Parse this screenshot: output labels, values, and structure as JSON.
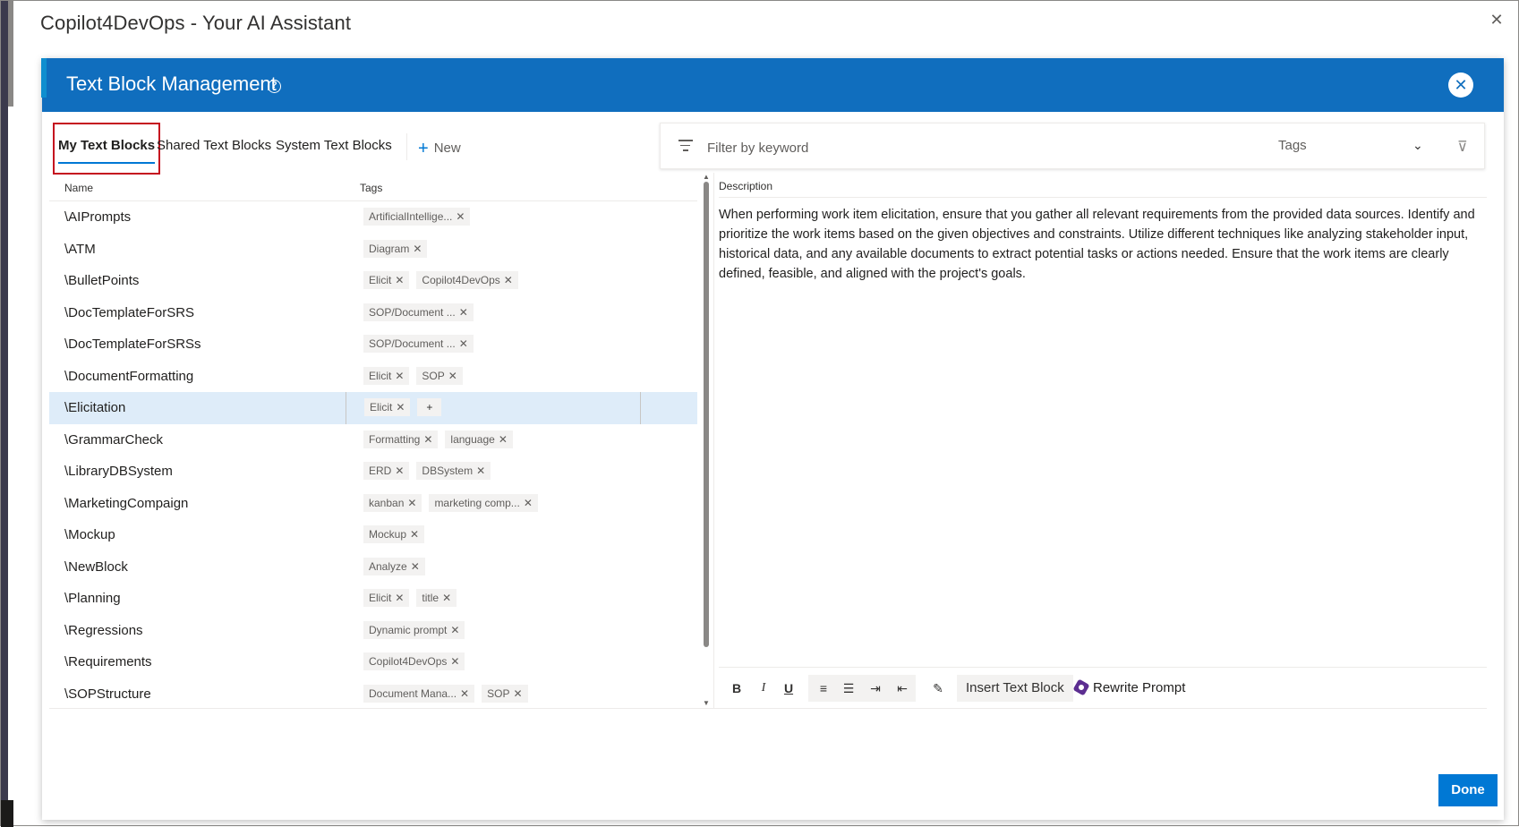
{
  "outer": {
    "title": "Copilot4DevOps - Your AI Assistant",
    "close_glyph": "✕"
  },
  "dialog": {
    "title": "Text Block Management",
    "help_glyph": "?",
    "close_glyph": "✕",
    "accent_color": "#106ebe"
  },
  "tabs": [
    {
      "label": "My Text Blocks",
      "active": true
    },
    {
      "label": "Shared Text Blocks",
      "active": false
    },
    {
      "label": "System Text Blocks",
      "active": false
    }
  ],
  "new_button": {
    "icon": "plus-icon",
    "glyph": "+",
    "label": "New"
  },
  "filter": {
    "placeholder": "Filter by keyword",
    "value": "",
    "tags_label": "Tags",
    "chevron_glyph": "⌄",
    "clear_glyph": "⊽"
  },
  "list": {
    "headers": {
      "name": "Name",
      "tags": "Tags"
    },
    "rows": [
      {
        "name": "\\AIPrompts",
        "tags": [
          "ArtificialIntellige..."
        ]
      },
      {
        "name": "\\ATM",
        "tags": [
          "Diagram"
        ]
      },
      {
        "name": "\\BulletPoints",
        "tags": [
          "Elicit",
          "Copilot4DevOps"
        ]
      },
      {
        "name": "\\DocTemplateForSRS",
        "tags": [
          "SOP/Document ..."
        ]
      },
      {
        "name": "\\DocTemplateForSRSs",
        "tags": [
          "SOP/Document ..."
        ]
      },
      {
        "name": "\\DocumentFormatting",
        "tags": [
          "Elicit",
          "SOP"
        ]
      },
      {
        "name": "\\Elicitation",
        "tags": [
          "Elicit"
        ],
        "selected": true,
        "add_tag": "+"
      },
      {
        "name": "\\GrammarCheck",
        "tags": [
          "Formatting",
          "language"
        ]
      },
      {
        "name": "\\LibraryDBSystem",
        "tags": [
          "ERD",
          "DBSystem"
        ]
      },
      {
        "name": "\\MarketingCompaign",
        "tags": [
          "kanban",
          "marketing comp..."
        ]
      },
      {
        "name": "\\Mockup",
        "tags": [
          "Mockup"
        ]
      },
      {
        "name": "\\NewBlock",
        "tags": [
          "Analyze"
        ]
      },
      {
        "name": "\\Planning",
        "tags": [
          "Elicit",
          "title"
        ]
      },
      {
        "name": "\\Regressions",
        "tags": [
          "Dynamic prompt"
        ]
      },
      {
        "name": "\\Requirements",
        "tags": [
          "Copilot4DevOps"
        ]
      },
      {
        "name": "\\SOPStructure",
        "tags": [
          "Document Mana...",
          "SOP"
        ]
      }
    ],
    "tag_remove_glyph": "✕",
    "scroll_up_glyph": "▲",
    "scroll_down_glyph": "▼"
  },
  "description": {
    "label": "Description",
    "text": "When performing work item elicitation, ensure that you gather all relevant requirements from the provided data sources. Identify and prioritize the work items based on the given objectives and constraints. Utilize different techniques like analyzing stakeholder input, historical data, and any available documents to extract potential tasks or actions needed. Ensure that the work items are clearly defined, feasible, and aligned with the project's goals."
  },
  "toolbar": {
    "bold": "B",
    "italic": "I",
    "underline": "U",
    "numbered_list_glyph": "≡",
    "bullet_list_glyph": "☰",
    "indent_glyph": "⇥",
    "outdent_glyph": "⇤",
    "clear_format_glyph": "✎",
    "insert_text_block": "Insert Text Block",
    "rewrite_prompt": "Rewrite Prompt"
  },
  "footer": {
    "done": "Done"
  }
}
